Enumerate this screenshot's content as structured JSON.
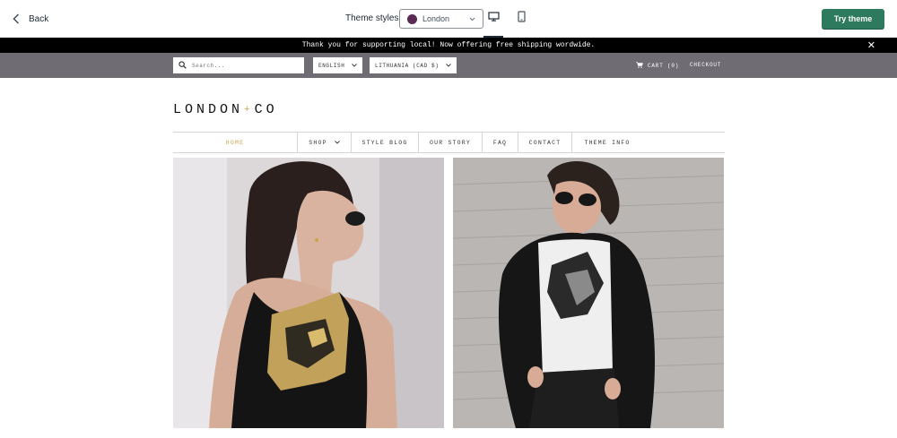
{
  "topbar": {
    "back_label": "Back",
    "styles_label": "Theme styles",
    "style_selected": "London",
    "style_swatch_color": "#5a2a52",
    "try_label": "Try theme",
    "try_color": "#2d7a5f"
  },
  "announcement": {
    "text": "Thank you for supporting local! Now offering free shipping wordwide."
  },
  "utility": {
    "search_placeholder": "Search...",
    "language": "ENGLISH",
    "country": "LITHUANIA (CAD $)",
    "cart_label": "CART (0)",
    "checkout_label": "CHECKOUT"
  },
  "logo": {
    "left": "LONDON",
    "plus": "+",
    "right": "CO"
  },
  "nav": {
    "items": [
      {
        "label": "HOME"
      },
      {
        "label": "SHOP"
      },
      {
        "label": "STYLE BLOG"
      },
      {
        "label": "OUR STORY"
      },
      {
        "label": "FAQ"
      },
      {
        "label": "CONTACT"
      },
      {
        "label": "THEME INFO"
      }
    ]
  },
  "colors": {
    "accent_gold": "#c9a44c",
    "utility_bar": "#6f6c74"
  }
}
